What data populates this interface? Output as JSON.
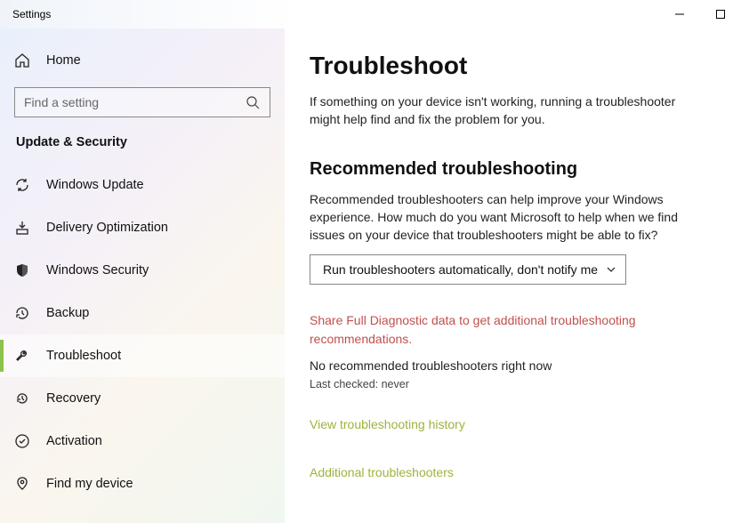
{
  "titlebar": {
    "title": "Settings"
  },
  "sidebar": {
    "home": "Home",
    "search_placeholder": "Find a setting",
    "section": "Update & Security",
    "items": [
      {
        "label": "Windows Update",
        "icon": "sync-icon"
      },
      {
        "label": "Delivery Optimization",
        "icon": "download-icon"
      },
      {
        "label": "Windows Security",
        "icon": "shield-icon"
      },
      {
        "label": "Backup",
        "icon": "backup-icon"
      },
      {
        "label": "Troubleshoot",
        "icon": "wrench-icon"
      },
      {
        "label": "Recovery",
        "icon": "recovery-icon"
      },
      {
        "label": "Activation",
        "icon": "check-circle-icon"
      },
      {
        "label": "Find my device",
        "icon": "location-icon"
      }
    ]
  },
  "main": {
    "title": "Troubleshoot",
    "sub": "If something on your device isn't working, running a troubleshooter might help find and fix the problem for you.",
    "rec_title": "Recommended troubleshooting",
    "rec_desc": "Recommended troubleshooters can help improve your Windows experience. How much do you want Microsoft to help when we find issues on your device that troubleshooters might be able to fix?",
    "dropdown_value": "Run troubleshooters automatically, don't notify me",
    "warn": "Share Full Diagnostic data to get additional troubleshooting recommendations.",
    "no_rec": "No recommended troubleshooters right now",
    "last_checked": "Last checked: never",
    "link_history": "View troubleshooting history",
    "link_additional": "Additional troubleshooters"
  }
}
